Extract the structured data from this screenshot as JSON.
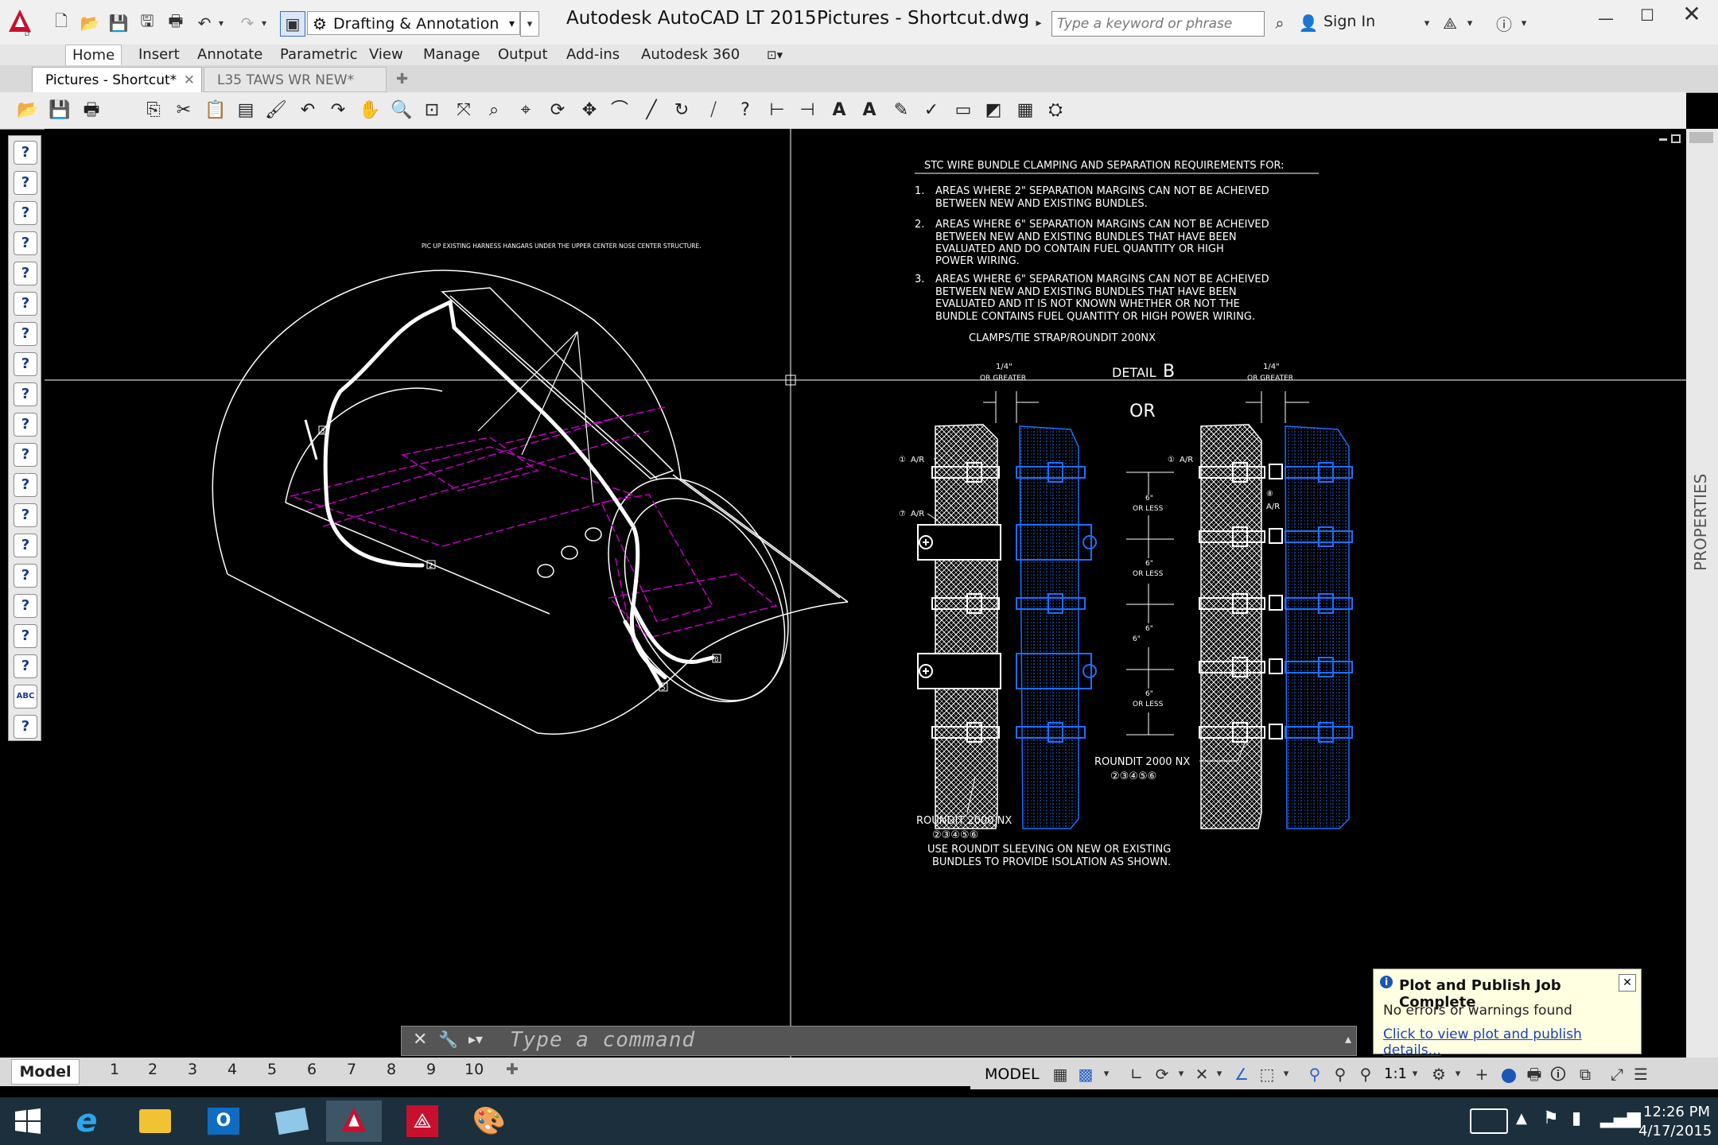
{
  "app": {
    "title": "Autodesk AutoCAD LT 2015",
    "document": "Pictures - Shortcut.dwg"
  },
  "workspace": "Drafting & Annotation",
  "search": {
    "placeholder": "Type a keyword or phrase"
  },
  "account": {
    "signin": "Sign In"
  },
  "ribbon": {
    "tabs": [
      "Home",
      "Insert",
      "Annotate",
      "Parametric",
      "View",
      "Manage",
      "Output",
      "Add-ins",
      "Autodesk 360"
    ]
  },
  "filetabs": [
    "Pictures - Shortcut*",
    "L35 TAWS WR NEW*"
  ],
  "drawing": {
    "callout": "PIC UP EXISTING HARNESS HANGARS UNDER THE UPPER CENTER NOSE CENTER STRUCTURE.",
    "markers": [
      "3",
      "2",
      "5",
      "8"
    ],
    "notes_title": "STC WIRE BUNDLE CLAMPING AND SEPARATION REQUIREMENTS FOR:",
    "notes": [
      {
        "num": "1.",
        "lines": [
          "AREAS WHERE 2\" SEPARATION MARGINS CAN NOT BE ACHEIVED",
          "BETWEEN NEW AND EXISTING BUNDLES."
        ]
      },
      {
        "num": "2.",
        "lines": [
          "AREAS WHERE 6\" SEPARATION MARGINS CAN NOT BE ACHEIVED",
          "BETWEEN NEW AND EXISTING BUNDLES THAT HAVE BEEN",
          "EVALUATED AND DO CONTAIN FUEL QUANTITY OR HIGH",
          "POWER WIRING."
        ]
      },
      {
        "num": "3.",
        "lines": [
          "AREAS WHERE 6\" SEPARATION MARGINS CAN NOT BE ACHEIVED",
          "BETWEEN NEW AND EXISTING BUNDLES THAT HAVE BEEN",
          "EVALUATED AND IT IS NOT KNOWN WHETHER OR NOT THE",
          "BUNDLE CONTAINS FUEL QUANTITY OR HIGH POWER WIRING."
        ]
      }
    ],
    "clamps": "CLAMPS/TIE STRAP/ROUNDIT 200NX",
    "detail": "DETAIL",
    "detail_letter": "B",
    "or": "OR",
    "gap_top": "1/4\"",
    "gap_bottom": "OR GREATER",
    "ref_ar_1": "A/R",
    "ref_ar_7": "A/R",
    "ref_ar_8": "A/R",
    "spacing_top": "6\"",
    "spacing_bottom": "OR LESS",
    "roundit": "ROUNDIT 2000 NX",
    "circled_refs": "②③④⑤⑥",
    "footer_lines": [
      "USE ROUNDIT SLEEVING ON NEW OR EXISTING",
      "BUNDLES TO PROVIDE ISOLATION AS SHOWN."
    ]
  },
  "properties_label": "PROPERTIES",
  "command": {
    "placeholder": "Type a command"
  },
  "layout": {
    "tabs": [
      "Model",
      "1",
      "2",
      "3",
      "4",
      "5",
      "6",
      "7",
      "8",
      "9",
      "10"
    ]
  },
  "status": {
    "model": "MODEL",
    "scale": "1:1"
  },
  "notification": {
    "title": "Plot and Publish Job Complete",
    "message": "No errors or warnings found",
    "link": "Click to view plot and publish details..."
  },
  "taskbar": {
    "time": "12:26 PM",
    "date": "4/17/2015"
  },
  "colors": {
    "accent": "#c8102e",
    "wire": "#ffffff",
    "purple": "#c000c0",
    "blue": "#1e6fff"
  }
}
